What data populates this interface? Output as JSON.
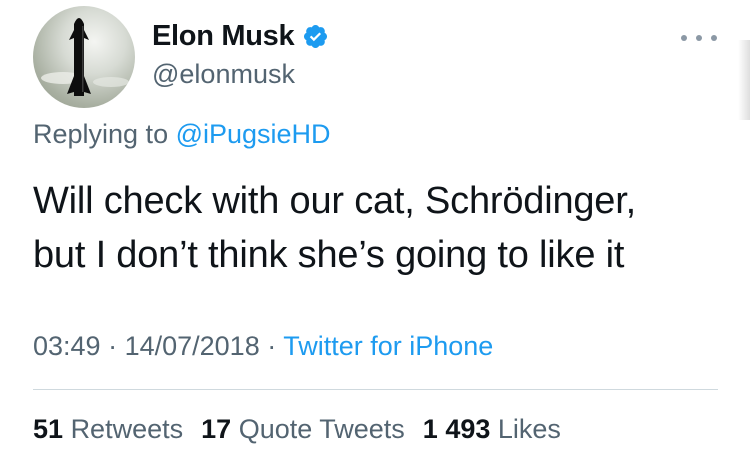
{
  "author": {
    "display_name": "Elon Musk",
    "handle": "@elonmusk",
    "verified": true,
    "avatar_icon": "starship-rocket-avatar"
  },
  "reply": {
    "prefix": "Replying to ",
    "mention": "@iPugsieHD"
  },
  "tweet": {
    "text_line1": "Will check with our cat, Schrödinger,",
    "text_line2": "but I don’t think she’s going to like it"
  },
  "meta": {
    "time": "03:49",
    "separator": " · ",
    "date": "14/07/2018",
    "source": "Twitter for iPhone"
  },
  "stats": {
    "retweets_count": "51",
    "retweets_label": "Retweets",
    "quotes_count": "17",
    "quotes_label": "Quote Tweets",
    "likes_count": "1 493",
    "likes_label": "Likes"
  },
  "colors": {
    "link": "#1d9bf0",
    "secondary": "#536471",
    "primary": "#0f1419",
    "verified": "#1d9bf0"
  }
}
